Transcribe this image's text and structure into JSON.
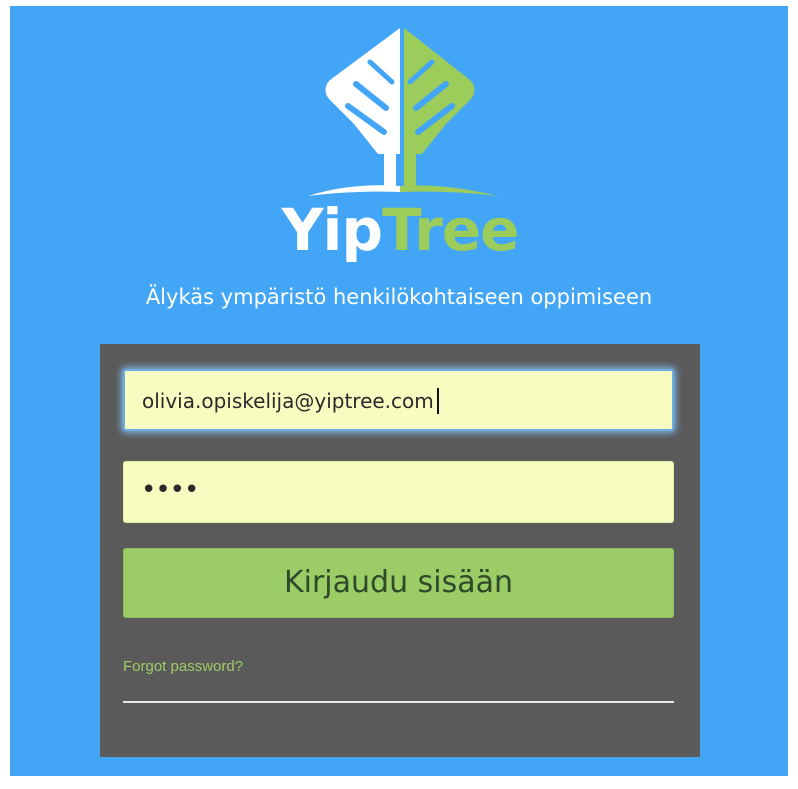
{
  "brand": {
    "name_part1": "Yip",
    "name_part2": "Tree",
    "tagline": "Älykäs ympäristö henkilökohtaiseen oppimiseen"
  },
  "colors": {
    "background": "#43a5f5",
    "panel": "#5a5a5a",
    "accent_green": "#9ccc65",
    "input_fill": "#f9fcc0",
    "logo_white": "#ffffff"
  },
  "login": {
    "email_value": "olivia.opiskelija@yiptree.com",
    "password_masked": "••••",
    "submit_label": "Kirjaudu sisään",
    "forgot_link": "Forgot password?"
  },
  "icons": {
    "logo": "tree-leaf-icon"
  }
}
